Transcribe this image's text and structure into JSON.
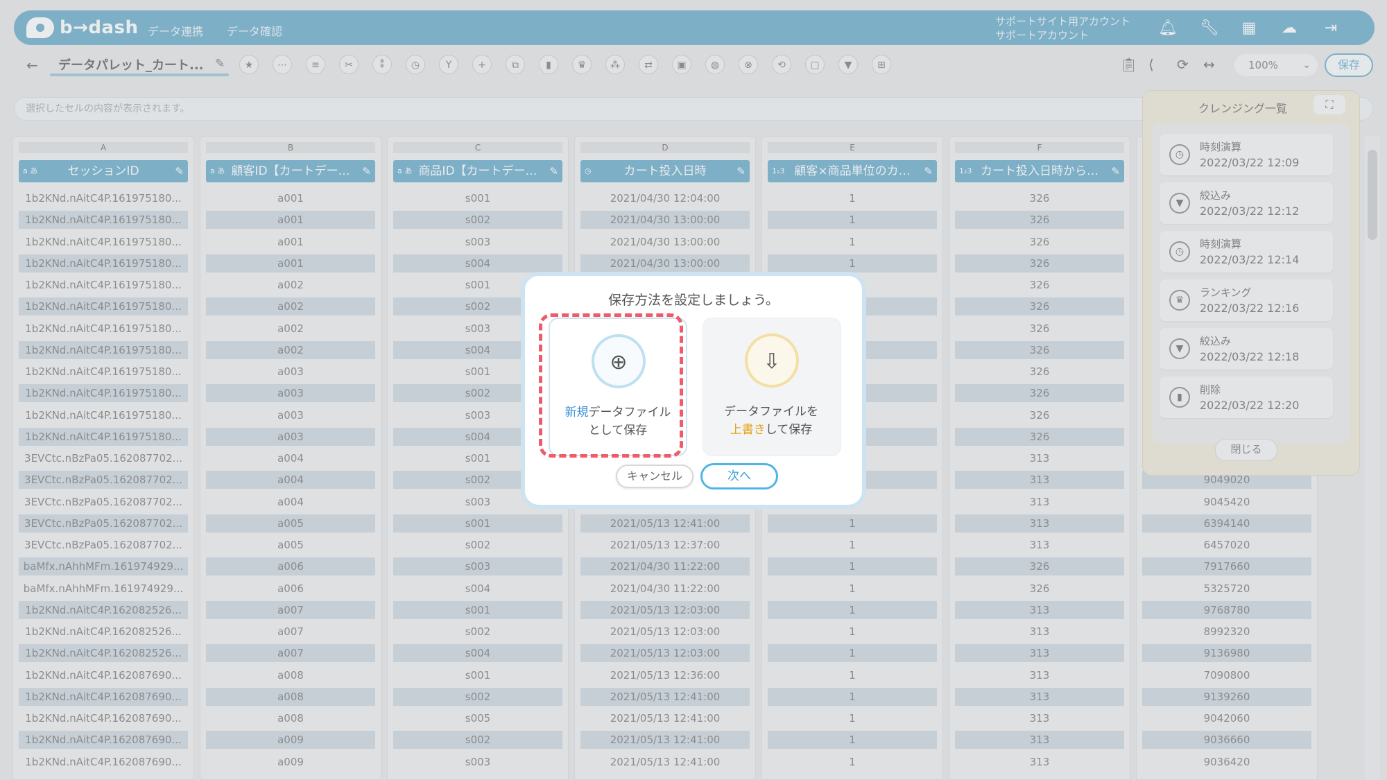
{
  "header": {
    "logo_text": "b→dash",
    "nav": [
      "データ連携",
      "データ確認"
    ],
    "account_line1": "サポートサイト用アカウント",
    "account_line2": "サポートアカウント"
  },
  "toolbar": {
    "file_name": "データパレット_カート...",
    "zoom": "100%",
    "save_label": "保存"
  },
  "cell_bar": {
    "placeholder": "選択したセルの内容が表示されます。"
  },
  "columns": [
    {
      "letter": "A",
      "type": "a あ",
      "name": "セッションID",
      "values": [
        "1b2KNd.nAitC4P.161975180...",
        "1b2KNd.nAitC4P.161975180...",
        "1b2KNd.nAitC4P.161975180...",
        "1b2KNd.nAitC4P.161975180...",
        "1b2KNd.nAitC4P.161975180...",
        "1b2KNd.nAitC4P.161975180...",
        "1b2KNd.nAitC4P.161975180...",
        "1b2KNd.nAitC4P.161975180...",
        "1b2KNd.nAitC4P.161975180...",
        "1b2KNd.nAitC4P.161975180...",
        "1b2KNd.nAitC4P.161975180...",
        "1b2KNd.nAitC4P.161975180...",
        "3EVCtc.nBzPa05.162087702...",
        "3EVCtc.nBzPa05.162087702...",
        "3EVCtc.nBzPa05.162087702...",
        "3EVCtc.nBzPa05.162087702...",
        "3EVCtc.nBzPa05.162087702...",
        "baMfx.nAhhMFm.161974929...",
        "baMfx.nAhhMFm.161974929...",
        "1b2KNd.nAitC4P.162082526...",
        "1b2KNd.nAitC4P.162082526...",
        "1b2KNd.nAitC4P.162082526...",
        "1b2KNd.nAitC4P.162087690...",
        "1b2KNd.nAitC4P.162087690...",
        "1b2KNd.nAitC4P.162087690...",
        "1b2KNd.nAitC4P.162087690...",
        "1b2KNd.nAitC4P.162087690..."
      ]
    },
    {
      "letter": "B",
      "type": "a あ",
      "name": "顧客ID【カートデー…",
      "values": [
        "a001",
        "a001",
        "a001",
        "a001",
        "a002",
        "a002",
        "a002",
        "a002",
        "a003",
        "a003",
        "a003",
        "a003",
        "a004",
        "a004",
        "a004",
        "a005",
        "a005",
        "a006",
        "a006",
        "a007",
        "a007",
        "a007",
        "a008",
        "a008",
        "a008",
        "a009",
        "a009"
      ]
    },
    {
      "letter": "C",
      "type": "a あ",
      "name": "商品ID【カートデー…",
      "values": [
        "s001",
        "s002",
        "s003",
        "s004",
        "s001",
        "s002",
        "s003",
        "s004",
        "s001",
        "s002",
        "s003",
        "s004",
        "s001",
        "s002",
        "s003",
        "s001",
        "s002",
        "s003",
        "s004",
        "s001",
        "s002",
        "s004",
        "s001",
        "s002",
        "s005",
        "s002",
        "s003"
      ]
    },
    {
      "letter": "D",
      "type": "◷",
      "name": "カート投入日時",
      "values": [
        "2021/04/30 12:04:00",
        "2021/04/30 13:00:00",
        "2021/04/30 13:00:00",
        "2021/04/30 13:00:00",
        "",
        "",
        "",
        "",
        "",
        "",
        "",
        "",
        "",
        "",
        "",
        "2021/05/13 12:41:00",
        "2021/05/13 12:37:00",
        "2021/04/30 11:22:00",
        "2021/04/30 11:22:00",
        "2021/05/13 12:03:00",
        "2021/05/13 12:03:00",
        "2021/05/13 12:03:00",
        "2021/05/13 12:36:00",
        "2021/05/13 12:41:00",
        "2021/05/13 12:41:00",
        "2021/05/13 12:41:00",
        "2021/05/13 12:41:00"
      ]
    },
    {
      "letter": "E",
      "type": "1₂3",
      "name": "顧客×商品単位のカ…",
      "values": [
        "1",
        "1",
        "1",
        "1",
        "",
        "",
        "",
        "",
        "",
        "",
        "",
        "",
        "",
        "",
        "",
        "1",
        "1",
        "1",
        "1",
        "1",
        "1",
        "1",
        "1",
        "1",
        "1",
        "1",
        "1"
      ]
    },
    {
      "letter": "F",
      "type": "1₂3",
      "name": "カート投入日時から…",
      "values": [
        "326",
        "326",
        "326",
        "326",
        "326",
        "326",
        "326",
        "326",
        "326",
        "326",
        "326",
        "326",
        "313",
        "313",
        "313",
        "313",
        "313",
        "326",
        "326",
        "313",
        "313",
        "313",
        "313",
        "313",
        "313",
        "313",
        "313"
      ]
    },
    {
      "letter": "",
      "type": "",
      "name": "",
      "values": [
        "",
        "",
        "",
        "",
        "",
        "",
        "",
        "",
        "",
        "",
        "",
        "",
        "",
        "9049020",
        "9045420",
        "6394140",
        "6457020",
        "7917660",
        "5325720",
        "9768780",
        "8992320",
        "9136980",
        "7090800",
        "9139260",
        "9042060",
        "9036660",
        "9036420"
      ]
    }
  ],
  "cleansing_panel": {
    "title": "クレンジング一覧",
    "items": [
      {
        "icon": "timer-icon",
        "name": "時刻演算",
        "date": "2022/03/22 12:09"
      },
      {
        "icon": "filter-icon",
        "name": "絞込み",
        "date": "2022/03/22 12:12"
      },
      {
        "icon": "timer-icon",
        "name": "時刻演算",
        "date": "2022/03/22 12:14"
      },
      {
        "icon": "crown-icon",
        "name": "ランキング",
        "date": "2022/03/22 12:16"
      },
      {
        "icon": "filter-icon",
        "name": "絞込み",
        "date": "2022/03/22 12:18"
      },
      {
        "icon": "trash-icon",
        "name": "削除",
        "date": "2022/03/22 12:20"
      }
    ],
    "close_label": "閉じる"
  },
  "modal": {
    "title": "保存方法を設定しましょう。",
    "option_new": {
      "highlight": "新規",
      "rest1": "データファイル",
      "line2": "として保存"
    },
    "option_overwrite": {
      "line1": "データファイルを",
      "highlight": "上書き",
      "rest2": "して保存"
    },
    "cancel_label": "キャンセル",
    "next_label": "次へ"
  }
}
